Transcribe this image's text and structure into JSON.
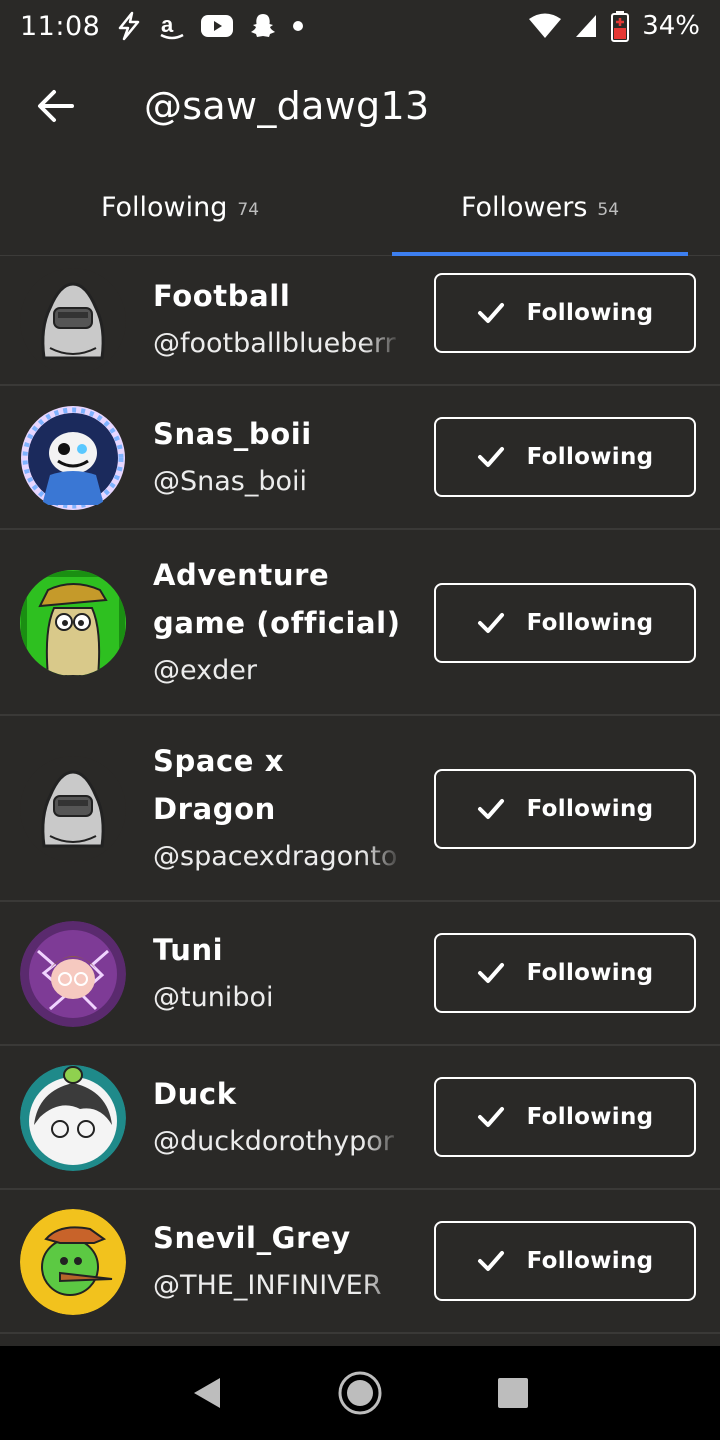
{
  "status_bar": {
    "time": "11:08",
    "battery_percent": "34%",
    "icons": [
      "flash-icon",
      "amazon-icon",
      "youtube-icon",
      "snapchat-icon",
      "dot-icon",
      "wifi-icon",
      "signal-icon",
      "battery-icon"
    ]
  },
  "header": {
    "title": "@saw_dawg13",
    "back_icon": "arrow-left-icon"
  },
  "tabs": [
    {
      "label": "Following",
      "count": "74",
      "active": false
    },
    {
      "label": "Followers",
      "count": "54",
      "active": true
    }
  ],
  "accent_color": "#3d7ff0",
  "list": [
    {
      "name": "Football",
      "username": "@footballblueberr",
      "button": "Following",
      "avatar": "grey-hooded-avatar"
    },
    {
      "name": "Snas_boii",
      "username": "@Snas_boii",
      "button": "Following",
      "avatar": "sans-blue-avatar"
    },
    {
      "name": "Adventure game (official)",
      "username": "@exder",
      "button": "Following",
      "avatar": "green-hat-avatar"
    },
    {
      "name": "Space x Dragon",
      "username": "@spacexdragonto",
      "button": "Following",
      "avatar": "grey-hooded-avatar"
    },
    {
      "name": "Tuni",
      "username": "@tuniboi",
      "button": "Following",
      "avatar": "purple-lightning-avatar"
    },
    {
      "name": "Duck",
      "username": "@duckdorothypor",
      "button": "Following",
      "avatar": "duck-teal-avatar"
    },
    {
      "name": "Snevil_Grey",
      "username": "@THE_INFINIVER",
      "button": "Following",
      "avatar": "green-ball-avatar"
    }
  ],
  "nav_bar": {
    "icons": [
      "back-triangle-icon",
      "home-circle-icon",
      "recents-square-icon"
    ]
  }
}
